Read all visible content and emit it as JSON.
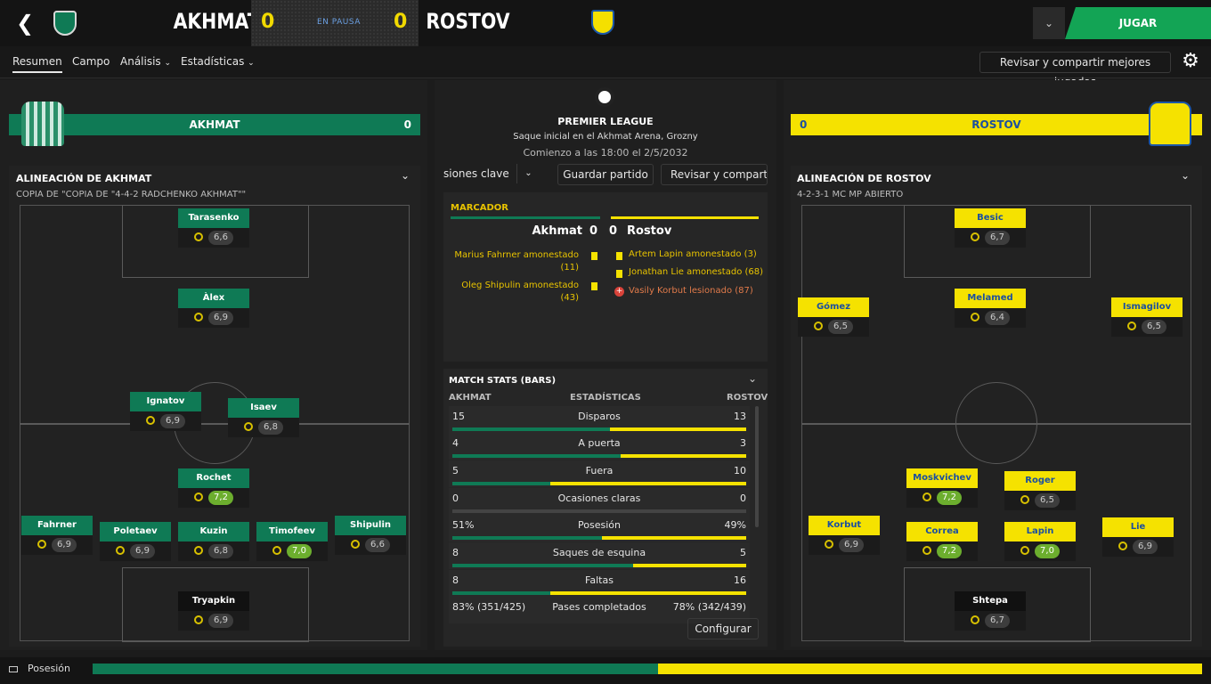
{
  "header": {
    "home": "AKHMAT",
    "away": "ROSTOV",
    "home_score": "0",
    "away_score": "0",
    "status": "EN PAUSA",
    "play_button": "JUGAR"
  },
  "nav": {
    "tabs": [
      "Resumen",
      "Campo",
      "Análisis",
      "Estadísticas"
    ],
    "review_button": "Revisar y compartir mejores jugadas"
  },
  "match": {
    "league": "PREMIER LEAGUE",
    "venue": "Saque inicial en el Akhmat Arena, Grozny",
    "kickoff": "Comienzo a las 18:00 el 2/5/2032",
    "buttons": [
      "siones clave",
      "Guardar partido",
      "Revisar y compartir r"
    ]
  },
  "teams": {
    "home": {
      "name": "AKHMAT",
      "score": "0",
      "lineup_title": "ALINEACIÓN DE AKHMAT",
      "formation": "COPIA DE \"COPIA DE \"4-4-2 RADCHENKO AKHMAT\"\""
    },
    "away": {
      "name": "ROSTOV",
      "score": "0",
      "lineup_title": "ALINEACIÓN DE ROSTOV",
      "formation": "4-2-3-1 MC MP ABIERTO"
    }
  },
  "scoreboard": {
    "title": "MARCADOR",
    "home": "Akhmat",
    "away": "Rostov",
    "home_score": "0",
    "away_score": "0",
    "home_events": [
      "Marius Fahrner amonestado (11)",
      "Oleg Shipulin amonestado (43)"
    ],
    "away_events": [
      "Artem Lapin amonestado (3)",
      "Jonathan Lie amonestado (68)",
      "Vasily Korbut lesionado (87)"
    ]
  },
  "stats": {
    "title": "MATCH STATS (BARS)",
    "col_home": "AKHMAT",
    "col_mid": "ESTADÍSTICAS",
    "col_away": "ROSTOV",
    "configure": "Configurar",
    "rows": [
      {
        "h": "15",
        "label": "Disparos",
        "a": "13",
        "hv": 15,
        "av": 13
      },
      {
        "h": "4",
        "label": "A puerta",
        "a": "3",
        "hv": 4,
        "av": 3
      },
      {
        "h": "5",
        "label": "Fuera",
        "a": "10",
        "hv": 5,
        "av": 10
      },
      {
        "h": "0",
        "label": "Ocasiones claras",
        "a": "0",
        "hv": 0,
        "av": 0
      },
      {
        "h": "51%",
        "label": "Posesión",
        "a": "49%",
        "hv": 51,
        "av": 49
      },
      {
        "h": "8",
        "label": "Saques de esquina",
        "a": "5",
        "hv": 8,
        "av": 5
      },
      {
        "h": "8",
        "label": "Faltas",
        "a": "16",
        "hv": 8,
        "av": 16
      },
      {
        "h": "83% (351/425)",
        "label": "Pases completados",
        "a": "78% (342/439)",
        "hv": 83,
        "av": 78
      }
    ]
  },
  "home_players": [
    {
      "name": "Tarasenko",
      "rating": "6,6"
    },
    {
      "name": "Àlex",
      "rating": "6,9"
    },
    {
      "name": "Ignatov",
      "rating": "6,9"
    },
    {
      "name": "Isaev",
      "rating": "6,8"
    },
    {
      "name": "Rochet",
      "rating": "7,2"
    },
    {
      "name": "Fahrner",
      "rating": "6,9"
    },
    {
      "name": "Poletaev",
      "rating": "6,9"
    },
    {
      "name": "Kuzin",
      "rating": "6,8"
    },
    {
      "name": "Timofeev",
      "rating": "7,0"
    },
    {
      "name": "Shipulin",
      "rating": "6,6"
    },
    {
      "name": "Tryapkin",
      "rating": "6,9"
    }
  ],
  "away_players": [
    {
      "name": "Besic",
      "rating": "6,7"
    },
    {
      "name": "Gómez",
      "rating": "6,5"
    },
    {
      "name": "Melamed",
      "rating": "6,4"
    },
    {
      "name": "Ismagilov",
      "rating": "6,5"
    },
    {
      "name": "Moskvichev",
      "rating": "7,2"
    },
    {
      "name": "Roger",
      "rating": "6,5"
    },
    {
      "name": "Korbut",
      "rating": "6,9"
    },
    {
      "name": "Correa",
      "rating": "7,2"
    },
    {
      "name": "Lapin",
      "rating": "7,0"
    },
    {
      "name": "Lie",
      "rating": "6,9"
    },
    {
      "name": "Shtepa",
      "rating": "6,7"
    }
  ],
  "footer": {
    "label": "Posesión",
    "home_pct": 51,
    "away_pct": 49
  },
  "colors": {
    "home": "#0f7a55",
    "away": "#f5e200",
    "accent": "#13a455"
  }
}
